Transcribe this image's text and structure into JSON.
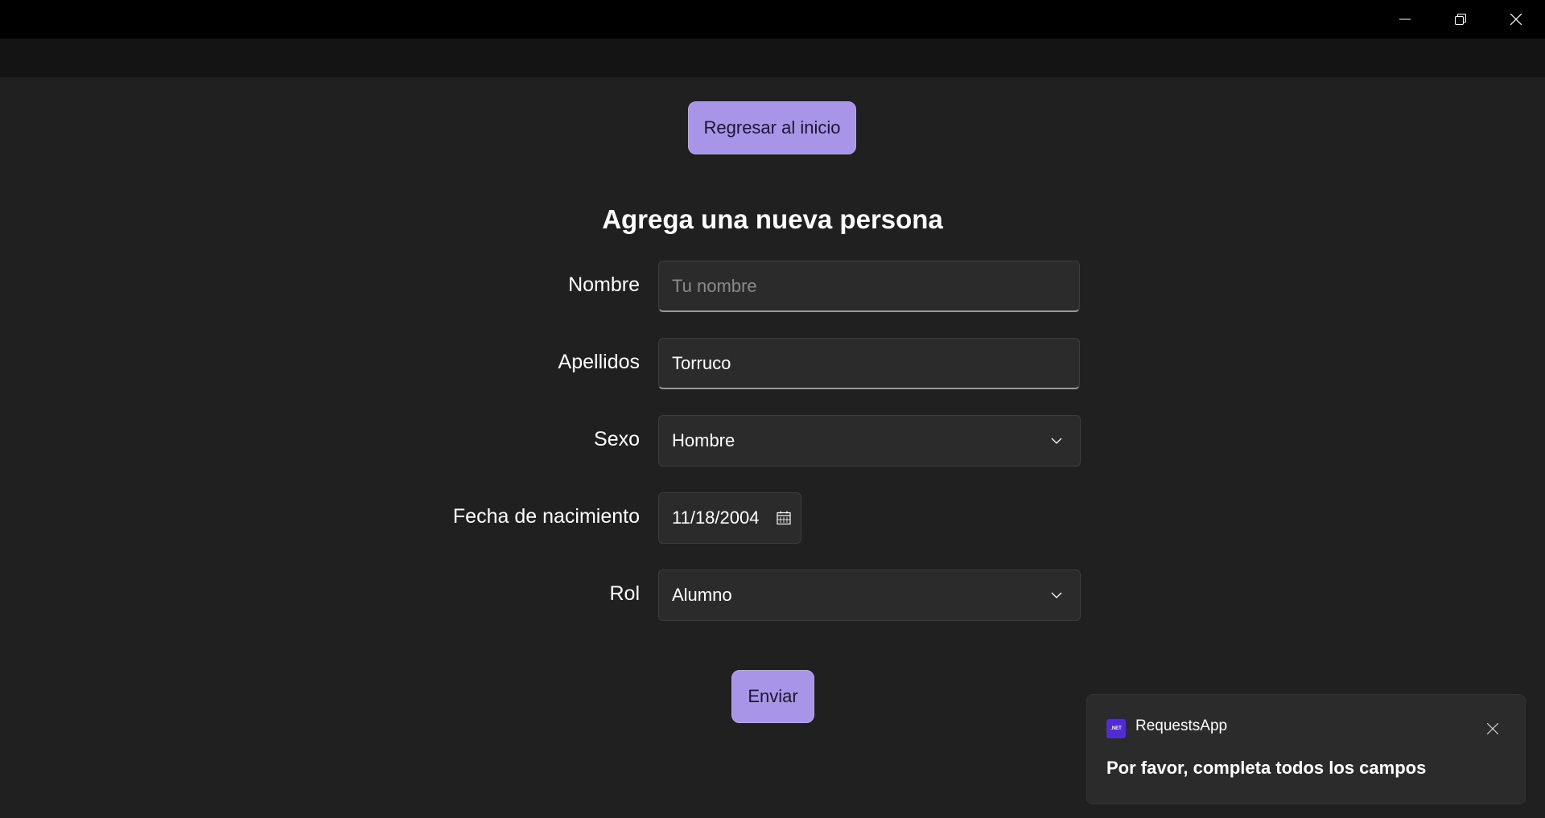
{
  "window": {
    "minimize_icon": "minimize-icon",
    "restore_icon": "restore-icon",
    "close_icon": "close-icon"
  },
  "nav": {
    "home_button_label": "Regresar al inicio"
  },
  "form": {
    "title": "Agrega una nueva persona",
    "fields": {
      "nombre": {
        "label": "Nombre",
        "value": "",
        "placeholder": "Tu nombre"
      },
      "apellidos": {
        "label": "Apellidos",
        "value": "Torruco"
      },
      "sexo": {
        "label": "Sexo",
        "value": "Hombre"
      },
      "fecha": {
        "label": "Fecha de nacimiento",
        "value": "11/18/2004"
      },
      "rol": {
        "label": "Rol",
        "value": "Alumno"
      }
    },
    "submit_label": "Enviar"
  },
  "toast": {
    "logo_text": ".NET",
    "app_name": "RequestsApp",
    "message": "Por favor, completa todos los campos"
  },
  "colors": {
    "accent": "#a995e8",
    "background": "#202020",
    "titlebar": "#000000",
    "navbar": "#141414",
    "dotnet_brand": "#512bd4"
  }
}
